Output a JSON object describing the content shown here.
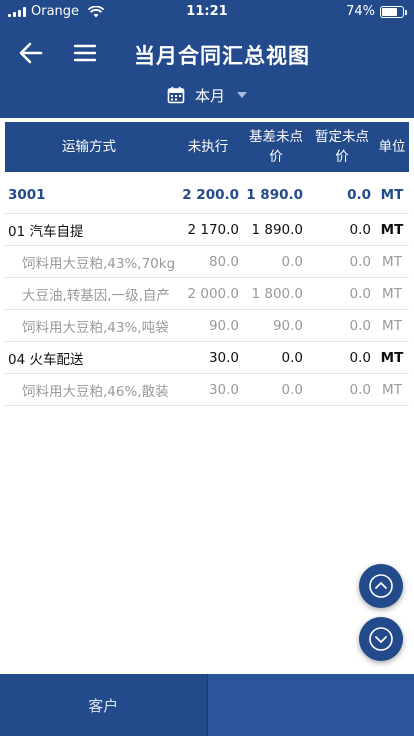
{
  "status_bar": {
    "carrier": "Orange",
    "time": "11:21",
    "battery_text": "74%",
    "battery_level": 0.74
  },
  "header": {
    "title": "当月合同汇总视图",
    "period_label": "本月"
  },
  "icons": {
    "back": "arrow-left-icon",
    "menu": "hamburger-icon",
    "calendar": "calendar-icon",
    "dropdown": "caret-down-icon",
    "up": "chevron-up-icon",
    "down": "chevron-down-icon"
  },
  "colors": {
    "primary": "#234a8a",
    "muted_text": "#9a9a9a"
  },
  "table": {
    "columns": [
      "运输方式",
      "未执行",
      "基差未点价",
      "暂定未点价",
      "单位"
    ],
    "rows": [
      {
        "level": 0,
        "name": "3001",
        "unexecuted": "2 200.0",
        "basis_unpriced": "1 890.0",
        "provisional_unpriced": "0.0",
        "unit": "MT"
      },
      {
        "level": 1,
        "name": "01 汽车自提",
        "unexecuted": "2 170.0",
        "basis_unpriced": "1 890.0",
        "provisional_unpriced": "0.0",
        "unit": "MT"
      },
      {
        "level": 2,
        "name": "饲料用大豆粕,43%,70kg",
        "unexecuted": "80.0",
        "basis_unpriced": "0.0",
        "provisional_unpriced": "0.0",
        "unit": "MT"
      },
      {
        "level": 2,
        "name": "大豆油,转基因,一级,自产",
        "unexecuted": "2 000.0",
        "basis_unpriced": "1 800.0",
        "provisional_unpriced": "0.0",
        "unit": "MT"
      },
      {
        "level": 2,
        "name": "饲料用大豆粕,43%,吨袋",
        "unexecuted": "90.0",
        "basis_unpriced": "90.0",
        "provisional_unpriced": "0.0",
        "unit": "MT"
      },
      {
        "level": 1,
        "name": "04 火车配送",
        "unexecuted": "30.0",
        "basis_unpriced": "0.0",
        "provisional_unpriced": "0.0",
        "unit": "MT"
      },
      {
        "level": 2,
        "name": "饲料用大豆粕,46%,散装",
        "unexecuted": "30.0",
        "basis_unpriced": "0.0",
        "provisional_unpriced": "0.0",
        "unit": "MT"
      }
    ]
  },
  "bottom_nav": {
    "tabs": [
      {
        "label": "客户"
      },
      {
        "label": ""
      }
    ]
  }
}
